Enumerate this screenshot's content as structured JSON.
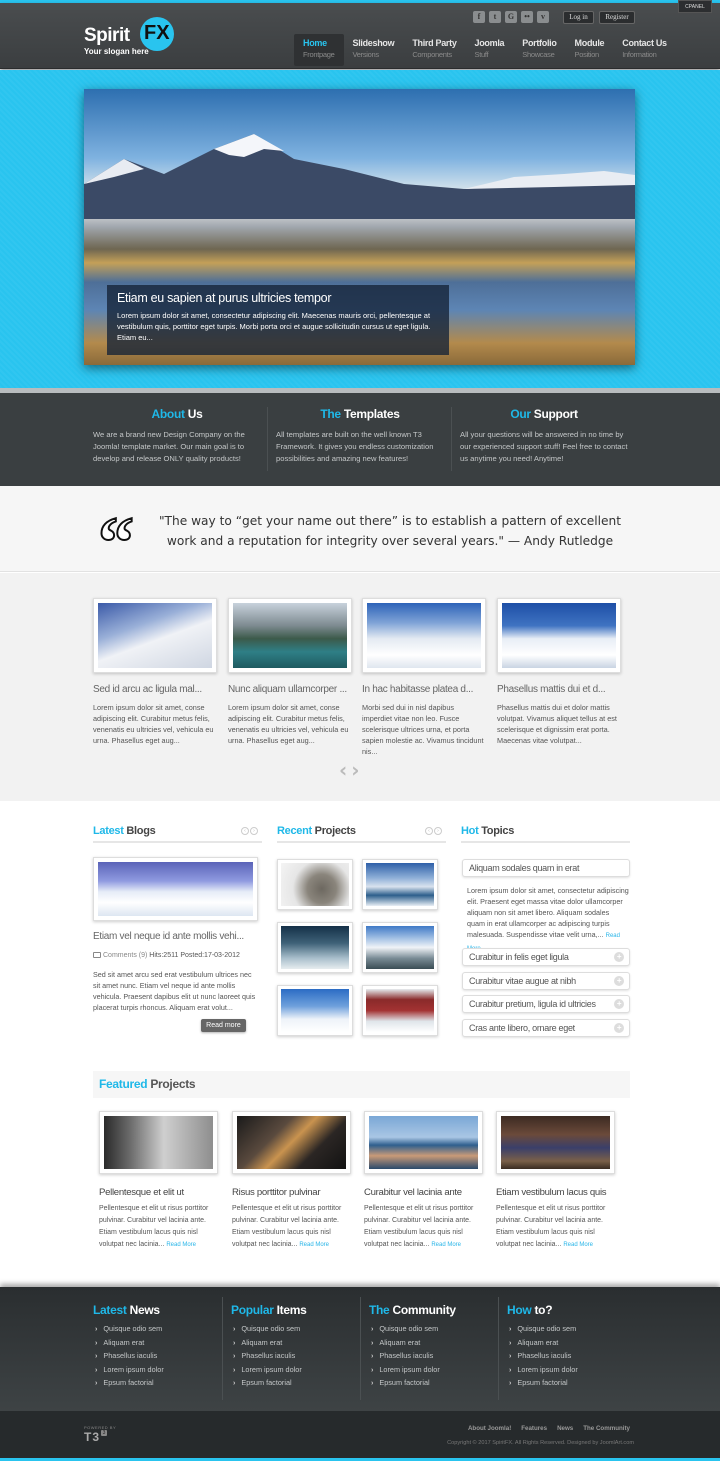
{
  "header": {
    "logo_text": "Spirit",
    "logo_badge": "FX",
    "slogan": "Your slogan here",
    "cpanel_label": "CPANEL",
    "social": [
      {
        "icon": "facebook-icon",
        "glyph": "f"
      },
      {
        "icon": "twitter-icon",
        "glyph": "t"
      },
      {
        "icon": "google-icon",
        "glyph": "G"
      },
      {
        "icon": "flickr-icon",
        "glyph": "••"
      },
      {
        "icon": "vimeo-icon",
        "glyph": "v"
      }
    ],
    "login_label": "Log in",
    "register_label": "Register",
    "nav": [
      {
        "title": "Home",
        "sub": "Frontpage",
        "active": true
      },
      {
        "title": "Slideshow",
        "sub": "Versions"
      },
      {
        "title": "Third Party",
        "sub": "Components"
      },
      {
        "title": "Joomla",
        "sub": "Stuff"
      },
      {
        "title": "Portfolio",
        "sub": "Showcase"
      },
      {
        "title": "Module",
        "sub": "Position"
      },
      {
        "title": "Contact Us",
        "sub": "Information"
      }
    ]
  },
  "hero": {
    "caption_title": "Etiam eu sapien at purus ultricies tempor",
    "caption_text": "Lorem ipsum dolor sit amet, consectetur adipiscing elit. Maecenas mauris orci, pellentesque at vestibulum quis, porttitor eget turpis. Morbi porta orci et augue sollicitudin cursus ut eget ligula. Etiam eu..."
  },
  "about": [
    {
      "accent": "About",
      "rest": "Us",
      "text": "We are a brand new Design Company on the Joomla! template market. Our main goal is to develop and release ONLY quality products!"
    },
    {
      "accent": "The",
      "rest": "Templates",
      "text": "All templates are built on the well known T3 Framework. It gives you endless customization possibilities and amazing new features!"
    },
    {
      "accent": "Our",
      "rest": "Support",
      "text": "All your questions will be answered in no time by our experienced support stuff! Feel free to contact us anytime you need! Anytime!"
    }
  ],
  "quote": {
    "mark": "“",
    "text": "\"The way to “get your name out there” is to establish a pattern of excellent work and a reputation for integrity over several years.\" — Andy Rutledge"
  },
  "carousel": {
    "items": [
      {
        "title": "Sed id arcu ac ligula mal...",
        "text": "Lorem ipsum dolor sit amet, conse adipiscing elit. Curabitur metus felis, venenatis eu ultricies vel, vehicula eu urna. Phasellus eget aug..."
      },
      {
        "title": "Nunc aliquam ullamcorper ...",
        "text": "Lorem ipsum dolor sit amet, conse adipiscing elit. Curabitur metus felis, venenatis eu ultricies vel, vehicula eu urna. Phasellus eget aug..."
      },
      {
        "title": "In hac habitasse platea d...",
        "text": "Morbi sed dui in nisl dapibus imperdiet vitae non leo. Fusce scelerisque ultrices urna, et porta sapien molestie ac. Vivamus tincidunt nis..."
      },
      {
        "title": "Phasellus mattis dui et d...",
        "text": "Phasellus mattis dui et dolor mattis volutpat. Vivamus aliquet tellus at est scelerisque et dignissim erat porta. Maecenas vitae volutpat..."
      }
    ],
    "prev": "‹",
    "next": "›"
  },
  "latest_blogs": {
    "accent": "Latest",
    "rest": "Blogs",
    "post_title": "Etiam vel neque id ante mollis vehi...",
    "comments": "Comments (9)",
    "hits": "Hits:2511",
    "posted": "Posted:17-03-2012",
    "text": "Sed sit amet arcu sed erat vestibulum ultrices nec sit amet nunc. Etiam vel neque id ante mollis vehicula. Praesent dapibus elit ut nunc laoreet quis placerat turpis rhoncus. Aliquam erat volut...",
    "read_more": "Read more"
  },
  "recent_projects": {
    "accent": "Recent",
    "rest": "Projects"
  },
  "hot_topics": {
    "accent": "Hot",
    "rest": "Topics",
    "open_title": "Aliquam sodales quam in erat",
    "open_text": "Lorem ipsum dolor sit amet, consectetur adipiscing elit. Praesent eget massa vitae dolor ullamcorper aliquam non sit amet libero. Aliquam sodales quam in erat ullamcorper ac adipiscing turpis malesuada. Suspendisse vitae velit urna,...",
    "read_more": "Read More",
    "items": [
      "Curabitur in felis eget ligula",
      "Curabitur vitae augue at nibh",
      "Curabitur pretium, ligula id ultricies",
      "Cras ante libero, ornare eget"
    ]
  },
  "featured": {
    "accent": "Featured",
    "rest": "Projects",
    "items": [
      {
        "title": "Pellentesque et elit ut",
        "text": "Pellentesque et elit ut risus porttitor pulvinar. Curabitur vel lacinia ante. Etiam vestibulum lacus quis nisl volutpat nec lacinia...",
        "read_more": "Read More"
      },
      {
        "title": "Risus porttitor pulvinar",
        "text": "Pellentesque et elit ut risus porttitor pulvinar. Curabitur vel lacinia ante. Etiam vestibulum lacus quis nisl volutpat nec lacinia...",
        "read_more": "Read More"
      },
      {
        "title": "Curabitur vel lacinia ante",
        "text": "Pellentesque et elit ut risus porttitor pulvinar. Curabitur vel lacinia ante. Etiam vestibulum lacus quis nisl volutpat nec lacinia...",
        "read_more": "Read More"
      },
      {
        "title": "Etiam vestibulum lacus quis",
        "text": "Pellentesque et elit ut risus porttitor pulvinar. Curabitur vel lacinia ante. Etiam vestibulum lacus quis nisl volutpat nec lacinia...",
        "read_more": "Read More"
      }
    ]
  },
  "footer": {
    "columns": [
      {
        "accent": "Latest",
        "rest": "News",
        "links": [
          "Quisque odio sem",
          "Aliquam erat",
          "Phasellus iaculis",
          "Lorem ipsum dolor",
          "Epsum factorial"
        ]
      },
      {
        "accent": "Popular",
        "rest": "Items",
        "links": [
          "Quisque odio sem",
          "Aliquam erat",
          "Phasellus iaculis",
          "Lorem ipsum dolor",
          "Epsum factorial"
        ]
      },
      {
        "accent": "The",
        "rest": "Community",
        "links": [
          "Quisque odio sem",
          "Aliquam erat",
          "Phasellus iaculis",
          "Lorem ipsum dolor",
          "Epsum factorial"
        ]
      },
      {
        "accent": "How",
        "rest": "to?",
        "links": [
          "Quisque odio sem",
          "Aliquam erat",
          "Phasellus iaculis",
          "Lorem ipsum dolor",
          "Epsum factorial"
        ]
      }
    ],
    "powered_by": "POWERED BY",
    "t3": "T3",
    "t3_badge": "3",
    "bottom_links": [
      "About Joomla!",
      "Features",
      "News",
      "The Community"
    ],
    "copyright": "Copyright © 2017 SpiritFX. All Rights Reserved. Designed by JoomlArt.com"
  },
  "colors": {
    "accent": "#29c4ef",
    "dark": "#3a3f41"
  }
}
